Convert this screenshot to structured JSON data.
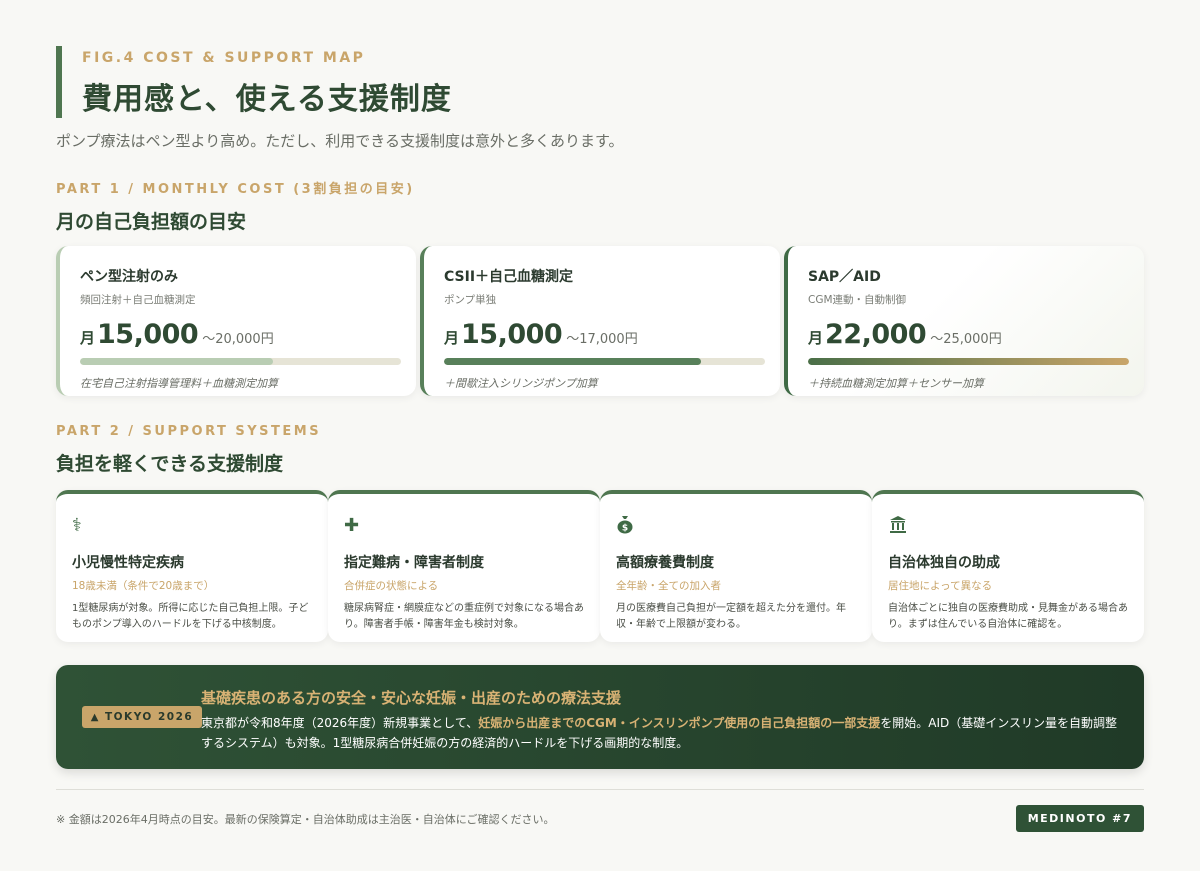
{
  "header": {
    "fig_label": "FIG.4 COST & SUPPORT MAP",
    "title": "費用感と、使える支援制度",
    "subtitle": "ポンプ療法はペン型より高め。ただし、利用できる支援制度は意外と多くあります。"
  },
  "part1": {
    "label": "PART 1 / MONTHLY COST (3割負担の目安)",
    "title": "月の自己負担額の目安",
    "cards": [
      {
        "name": "ペン型注射のみ",
        "sub": "頻回注射＋自己血糖測定",
        "prefix": "月",
        "amount": "15,000",
        "range": "〜20,000円",
        "fill_fraction": 0.6,
        "note": "在宅自己注射指導管理料＋血糖測定加算"
      },
      {
        "name": "CSII＋自己血糖測定",
        "sub": "ポンプ単独",
        "prefix": "月",
        "amount": "15,000",
        "range": "〜17,000円",
        "fill_fraction": 0.8,
        "note": "＋間歇注入シリンジポンプ加算"
      },
      {
        "name": "SAP／AID",
        "sub": "CGM連動・自動制御",
        "prefix": "月",
        "amount": "22,000",
        "range": "〜25,000円",
        "fill_fraction": 1.0,
        "note": "＋持続血糖測定加算＋センサー加算"
      }
    ]
  },
  "part2": {
    "label": "PART 2 / SUPPORT SYSTEMS",
    "title": "負担を軽くできる支援制度",
    "cards": [
      {
        "icon": "stethoscope-icon",
        "glyph": "⚕",
        "name": "小児慢性特定疾病",
        "tag": "18歳未満（条件で20歳まで）",
        "desc": "1型糖尿病が対象。所得に応じた自己負担上限。子どものポンプ導入のハードルを下げる中核制度。"
      },
      {
        "icon": "hospital-icon",
        "glyph": "✚",
        "name": "指定難病・障害者制度",
        "tag": "合併症の状態による",
        "desc": "糖尿病腎症・網膜症などの重症例で対象になる場合あり。障害者手帳・障害年金も検討対象。"
      },
      {
        "icon": "money-bag-icon",
        "glyph": "$",
        "name": "高額療養費制度",
        "tag": "全年齢・全ての加入者",
        "desc": "月の医療費自己負担が一定額を超えた分を還付。年収・年齢で上限額が変わる。"
      },
      {
        "icon": "government-building-icon",
        "glyph": "🏛",
        "name": "自治体独自の助成",
        "tag": "居住地によって異なる",
        "desc": "自治体ごとに独自の医療費助成・見舞金がある場合あり。まずは住んでいる自治体に確認を。"
      }
    ]
  },
  "banner": {
    "badge": "TOKYO 2026",
    "title": "基礎疾患のある方の安全・安心な妊娠・出産のための療法支援",
    "body_pre": "東京都が令和8年度（2026年度）新規事業として、",
    "body_highlight": "妊娠から出産までのCGM・インスリンポンプ使用の自己負担額の一部支援",
    "body_post": "を開始。AID（基礎インスリン量を自動調整するシステム）も対象。1型糖尿病合併妊娠の方の経済的ハードルを下げる画期的な制度。"
  },
  "footer": {
    "note": "※ 金額は2026年4月時点の目安。最新の保険算定・自治体助成は主治医・自治体にご確認ください。",
    "brand": "MEDINOTO #7"
  },
  "colors": {
    "accent_green": "#4f7650",
    "dark_green": "#2f5236",
    "gold": "#c9a56a",
    "light_green": "#b9cdb3"
  }
}
